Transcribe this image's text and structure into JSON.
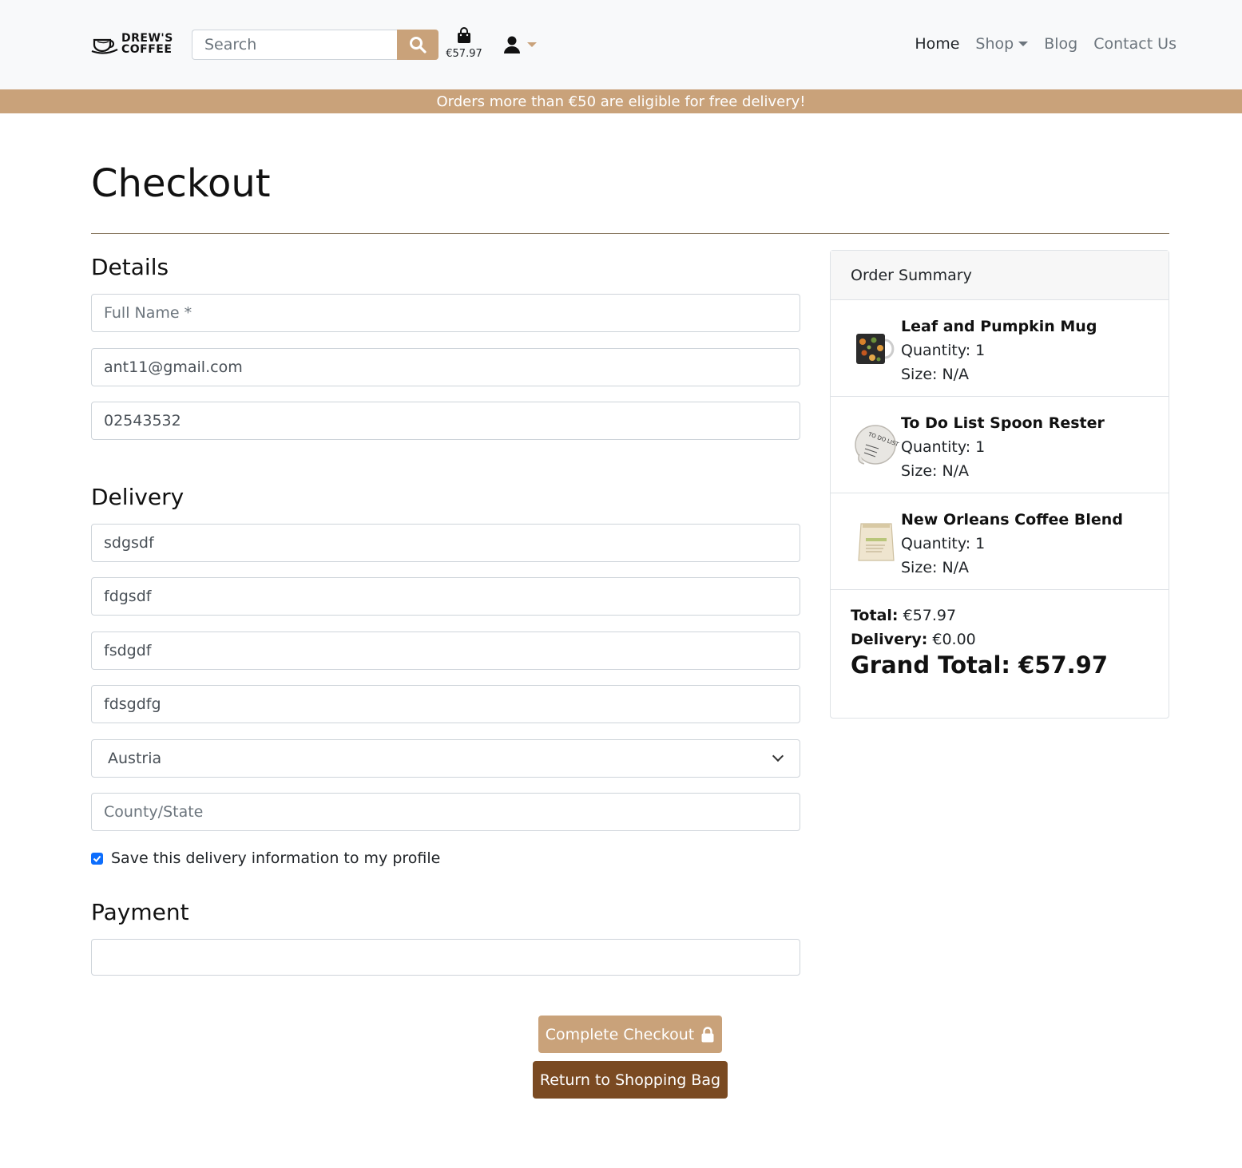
{
  "header": {
    "logo_line1": "DREW'S",
    "logo_line2": "COFFEE",
    "search_placeholder": "Search",
    "bag_total": "€57.97",
    "nav": [
      {
        "label": "Home"
      },
      {
        "label": "Shop"
      },
      {
        "label": "Blog"
      },
      {
        "label": "Contact Us"
      }
    ]
  },
  "banner": {
    "text": "Orders more than €50 are eligible for free delivery!"
  },
  "page": {
    "title": "Checkout"
  },
  "details": {
    "title": "Details",
    "full_name_placeholder": "Full Name *",
    "email": "ant11@gmail.com",
    "phone": "02543532"
  },
  "delivery": {
    "title": "Delivery",
    "address1": "sdgsdf",
    "address2": "fdgsdf",
    "town": "fsdgdf",
    "postcode": "fdsgdfg",
    "country": "Austria",
    "county_placeholder": "County/State",
    "save_label": "Save this delivery information to my profile",
    "save_checked": true
  },
  "payment": {
    "title": "Payment"
  },
  "buttons": {
    "complete": "Complete Checkout",
    "return": "Return to Shopping Bag"
  },
  "summary": {
    "title": "Order Summary",
    "items": [
      {
        "name": "Leaf and Pumpkin Mug",
        "quantity": "Quantity: 1",
        "size": "Size: N/A",
        "icon": "mug-thumbnail"
      },
      {
        "name": "To Do List Spoon Rester",
        "quantity": "Quantity: 1",
        "size": "Size: N/A",
        "icon": "spoon-rest-thumbnail"
      },
      {
        "name": "New Orleans Coffee Blend",
        "quantity": "Quantity: 1",
        "size": "Size: N/A",
        "icon": "coffee-bag-thumbnail"
      }
    ],
    "total_label": "Total:",
    "total_value": "€57.97",
    "delivery_label": "Delivery:",
    "delivery_value": "€0.00",
    "grand_label": "Grand Total:",
    "grand_value": "€57.97"
  },
  "colors": {
    "accent": "#c9a27a",
    "dark_brown": "#7a4a22",
    "checkbox": "#0d6efd"
  }
}
